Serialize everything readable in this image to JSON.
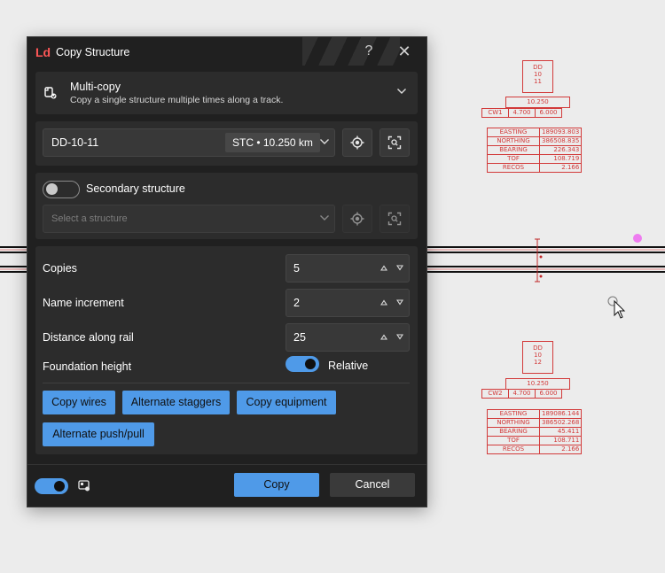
{
  "dialog": {
    "logo": "Ld",
    "title": "Copy Structure",
    "help_glyph": "?",
    "close_glyph": "✕"
  },
  "mode": {
    "title": "Multi-copy",
    "description": "Copy a single structure multiple times along a track."
  },
  "structure": {
    "name": "DD-10-11",
    "chip": "STC • 10.250 km"
  },
  "secondary": {
    "label": "Secondary structure",
    "enabled": false,
    "placeholder": "Select a structure"
  },
  "options": {
    "copies_label": "Copies",
    "copies_value": "5",
    "name_increment_label": "Name increment",
    "name_increment_value": "2",
    "distance_label": "Distance along rail",
    "distance_value": "25",
    "foundation_label": "Foundation height",
    "foundation_value": "Relative",
    "buttons": {
      "copy_wires": "Copy wires",
      "alternate_staggers": "Alternate staggers",
      "copy_equipment": "Copy equipment",
      "alternate_push_pull": "Alternate push/pull"
    }
  },
  "footer": {
    "copy_label": "Copy",
    "cancel_label": "Cancel"
  },
  "colors": {
    "accent": "#4f9ae8",
    "logo": "#ff5757",
    "dialog_bg": "#202020",
    "panel_bg": "#2c2c2c",
    "cad_red": "#d23a3a",
    "cad_magenta": "#ee7cf0"
  },
  "cad": {
    "top": {
      "id_lines": [
        "DD",
        "10",
        "11"
      ],
      "chainage": "10.250",
      "cw_row": [
        "CW1",
        "4.700",
        "6.000"
      ],
      "rows": [
        {
          "label": "EASTING",
          "value": "189093.803"
        },
        {
          "label": "NORTHING",
          "value": "386508.835"
        },
        {
          "label": "BEARING",
          "value": "226.343"
        },
        {
          "label": "TOF",
          "value": "108.719"
        },
        {
          "label": "RECOS",
          "value": "2.166"
        }
      ]
    },
    "bottom": {
      "id_lines": [
        "DD",
        "10",
        "12"
      ],
      "chainage": "10.250",
      "cw_row": [
        "CW2",
        "4.700",
        "6.000"
      ],
      "rows": [
        {
          "label": "EASTING",
          "value": "189086.144"
        },
        {
          "label": "NORTHING",
          "value": "386502.268"
        },
        {
          "label": "BEARING",
          "value": "45.411"
        },
        {
          "label": "TOF",
          "value": "108.711"
        },
        {
          "label": "RECOS",
          "value": "2.166"
        }
      ]
    }
  }
}
